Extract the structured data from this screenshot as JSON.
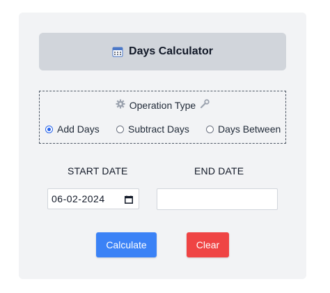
{
  "header": {
    "title": "Days Calculator",
    "icon": "calendar-icon"
  },
  "operation": {
    "title": "Operation Type",
    "left_icon": "gear-icon",
    "right_icon": "wrench-icon",
    "options": [
      {
        "label": "Add Days",
        "checked": true
      },
      {
        "label": "Subtract Days",
        "checked": false
      },
      {
        "label": "Days Between",
        "checked": false
      }
    ]
  },
  "fields": {
    "start_label": "START DATE",
    "end_label": "END DATE",
    "start_value": "06-02-2024",
    "end_value": ""
  },
  "buttons": {
    "calculate": "Calculate",
    "clear": "Clear"
  },
  "colors": {
    "accent": "#3b82f6",
    "danger": "#ef4444",
    "header_bg": "#d1d5db"
  }
}
